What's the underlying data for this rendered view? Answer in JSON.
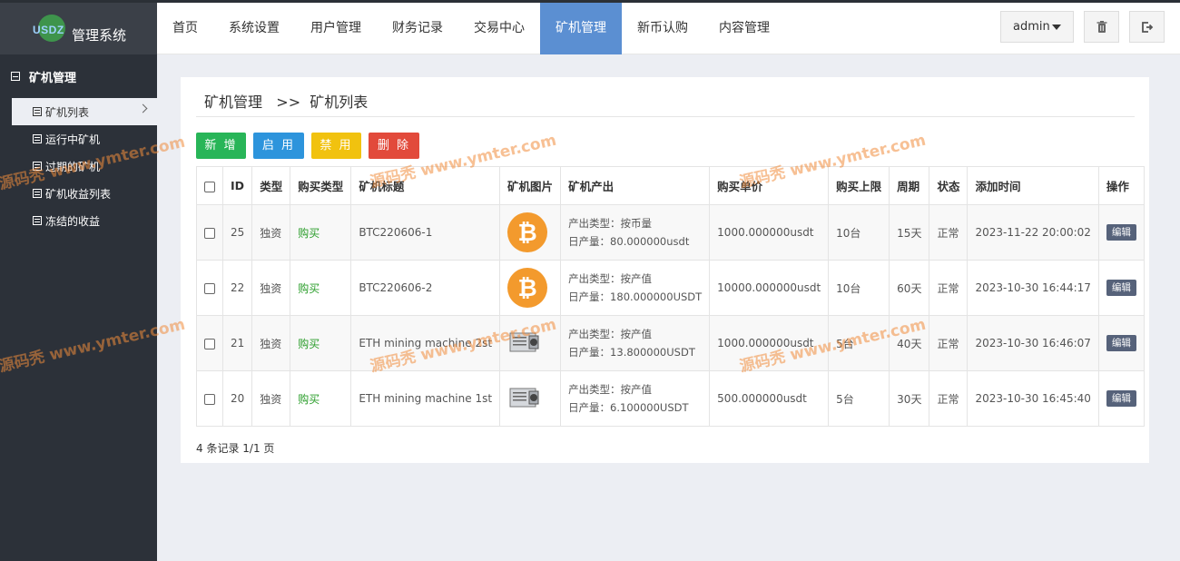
{
  "app": {
    "logo_mark": "USDZ",
    "logo_title": "管理系统"
  },
  "sidebar": {
    "section_title": "矿机管理",
    "items": [
      {
        "label": "矿机列表",
        "active": true
      },
      {
        "label": "运行中矿机"
      },
      {
        "label": "过期的矿机"
      },
      {
        "label": "矿机收益列表"
      },
      {
        "label": "冻结的收益"
      }
    ]
  },
  "topnav": {
    "items": [
      "首页",
      "系统设置",
      "用户管理",
      "财务记录",
      "交易中心",
      "矿机管理",
      "新币认购",
      "内容管理"
    ],
    "active": "矿机管理",
    "user": "admin"
  },
  "breadcrumb": {
    "parent": "矿机管理",
    "separator": ">>",
    "current": "矿机列表"
  },
  "actions": {
    "add": "新 增",
    "enable": "启 用",
    "disable": "禁 用",
    "delete": "删 除"
  },
  "colors": {
    "add": "#28b558",
    "enable": "#2d94dc",
    "disable": "#f1c20f",
    "delete": "#e24a3b",
    "nav_active": "#5b8fd2",
    "sidebar": "#2c3139"
  },
  "table": {
    "headers": [
      "ID",
      "类型",
      "购买类型",
      "矿机标题",
      "矿机图片",
      "矿机产出",
      "购买单价",
      "购买上限",
      "周期",
      "状态",
      "添加时间",
      "操作"
    ],
    "rows": [
      {
        "id": "25",
        "type": "独资",
        "buy_type": "购买",
        "title": "BTC220606-1",
        "image": "bitcoin-icon",
        "output_type": "产出类型：按币量",
        "daily": "日产量：80.000000usdt",
        "price": "1000.000000usdt",
        "limit": "10台",
        "period": "15天",
        "status": "正常",
        "time": "2023-11-22 20:00:02",
        "action": "编辑"
      },
      {
        "id": "22",
        "type": "独资",
        "buy_type": "购买",
        "title": "BTC220606-2",
        "image": "bitcoin-icon",
        "output_type": "产出类型：按产值",
        "daily": "日产量：180.000000USDT",
        "price": "10000.000000usdt",
        "limit": "10台",
        "period": "60天",
        "status": "正常",
        "time": "2023-10-30 16:44:17",
        "action": "编辑"
      },
      {
        "id": "21",
        "type": "独资",
        "buy_type": "购买",
        "title": "ETH mining machine 2st",
        "image": "miner-icon",
        "output_type": "产出类型：按产值",
        "daily": "日产量：13.800000USDT",
        "price": "1000.000000usdt",
        "limit": "5台",
        "period": "40天",
        "status": "正常",
        "time": "2023-10-30 16:46:07",
        "action": "编辑"
      },
      {
        "id": "20",
        "type": "独资",
        "buy_type": "购买",
        "title": "ETH mining machine 1st",
        "image": "miner-icon",
        "output_type": "产出类型：按产值",
        "daily": "日产量：6.100000USDT",
        "price": "500.000000usdt",
        "limit": "5台",
        "period": "30天",
        "status": "正常",
        "time": "2023-10-30 16:45:40",
        "action": "编辑"
      }
    ]
  },
  "footer": {
    "summary": "4 条记录 1/1 页"
  },
  "watermark": {
    "text": "源码秃 www.ymter.com"
  }
}
